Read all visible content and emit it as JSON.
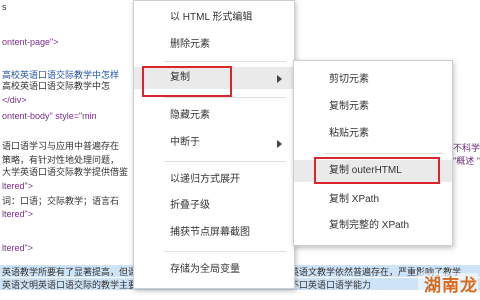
{
  "source_view": {
    "lines": [
      {
        "text": "s",
        "cls": "dark"
      },
      {
        "text": "",
        "cls": "dark"
      },
      {
        "text": "ontent-page\">",
        "cls": "purple"
      },
      {
        "text": "",
        "cls": "dark"
      },
      {
        "text": "高校英语口语交际教学中怎样",
        "cls": "blue"
      },
      {
        "text": "高校英语口语交际教学中怎",
        "cls": "dark"
      },
      {
        "text": "</div>",
        "cls": "purple"
      },
      {
        "text": "ontent-body\" style=\"min",
        "cls": "purple"
      },
      {
        "text": "",
        "cls": "dark"
      },
      {
        "text": "语口语学习与应用中普遍存在",
        "cls": "dark"
      },
      {
        "text": "策略，有针对性地处理问题，",
        "cls": "dark"
      },
      {
        "text": "大学英语口语交际教学提供借鉴",
        "cls": "dark"
      },
      {
        "text": "ltered\">",
        "cls": "purple"
      },
      {
        "text": "词：口语；交际教学；语言石",
        "cls": "dark"
      },
      {
        "text": "ltered\">",
        "cls": "purple"
      },
      {
        "text": "",
        "cls": "dark"
      },
      {
        "text": "",
        "cls": "dark"
      },
      {
        "text": "",
        "cls": "dark"
      },
      {
        "text": "ltered\">",
        "cls": "purple"
      }
    ],
    "right_edge_1": "不科学",
    "right_edge_2": "\"概述 \"",
    "selected_line_1": "英语教学所要有了显著提高，但课堂教学模式依然采用着讲的传统模式，英语文教学依然普遍存在，严重影响了教学",
    "selected_line_2": "英语文明英语口语交际的教学主要口语已经提高了公提供数学提升，教师不口英语口语学能力"
  },
  "main_menu": {
    "items": [
      {
        "label": "以 HTML 形式编辑",
        "has_arrow": false
      },
      {
        "label": "删除元素",
        "has_arrow": false
      },
      {
        "label": "复制",
        "has_arrow": true,
        "highlighted": true
      },
      {
        "label": "隐藏元素",
        "has_arrow": false
      },
      {
        "label": "中断于",
        "has_arrow": true
      },
      {
        "label": "以递归方式展开",
        "has_arrow": false
      },
      {
        "label": "折叠子级",
        "has_arrow": false
      },
      {
        "label": "捕获节点屏幕截图",
        "has_arrow": false
      },
      {
        "label": "存储为全局变量",
        "has_arrow": false
      }
    ]
  },
  "sub_menu": {
    "items": [
      {
        "label": "剪切元素"
      },
      {
        "label": "复制元素"
      },
      {
        "label": "粘贴元素"
      },
      {
        "label": "复制 outerHTML",
        "highlighted": true
      },
      {
        "label": "复制 XPath"
      },
      {
        "label": "复制完整的 XPath"
      }
    ]
  },
  "watermark": {
    "text": "湖南龙"
  },
  "colors": {
    "highlight_box": "#d9262c",
    "selection": "#cfe3f7"
  }
}
